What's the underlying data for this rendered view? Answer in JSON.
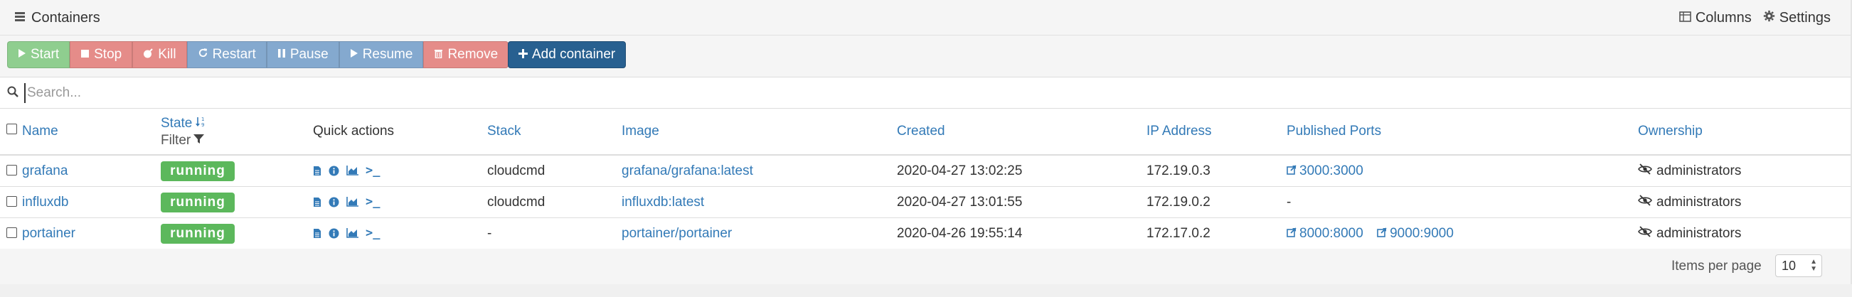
{
  "header": {
    "title": "Containers",
    "columns_label": "Columns",
    "settings_label": "Settings"
  },
  "toolbar": {
    "start": "Start",
    "stop": "Stop",
    "kill": "Kill",
    "restart": "Restart",
    "pause": "Pause",
    "resume": "Resume",
    "remove": "Remove",
    "add": "Add container"
  },
  "search": {
    "placeholder": "Search..."
  },
  "table": {
    "headers": {
      "name": "Name",
      "state": "State",
      "filter": "Filter",
      "quick_actions": "Quick actions",
      "stack": "Stack",
      "image": "Image",
      "created": "Created",
      "ip": "IP Address",
      "ports": "Published Ports",
      "ownership": "Ownership"
    },
    "rows": [
      {
        "name": "grafana",
        "state": "running",
        "stack": "cloudcmd",
        "image": "grafana/grafana:latest",
        "created": "2020-04-27 13:02:25",
        "ip": "172.19.0.3",
        "ports": [
          "3000:3000"
        ],
        "ports_empty": "",
        "ownership": "administrators"
      },
      {
        "name": "influxdb",
        "state": "running",
        "stack": "cloudcmd",
        "image": "influxdb:latest",
        "created": "2020-04-27 13:01:55",
        "ip": "172.19.0.2",
        "ports": [],
        "ports_empty": "-",
        "ownership": "administrators"
      },
      {
        "name": "portainer",
        "state": "running",
        "stack": "-",
        "image": "portainer/portainer",
        "created": "2020-04-26 19:55:14",
        "ip": "172.17.0.2",
        "ports": [
          "8000:8000",
          "9000:9000"
        ],
        "ports_empty": "",
        "ownership": "administrators"
      }
    ]
  },
  "footer": {
    "items_per_page_label": "Items per page",
    "items_per_page_value": "10"
  },
  "colors": {
    "running": "#5cb85c",
    "link": "#337ab7",
    "primary": "#286090"
  }
}
